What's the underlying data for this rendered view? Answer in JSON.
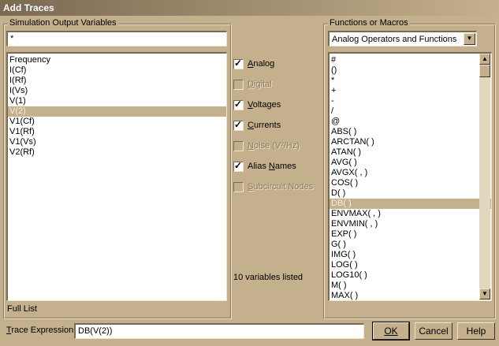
{
  "window": {
    "title": "Add Traces"
  },
  "simulation_group": {
    "legend": "Simulation Output Variables",
    "filter_value": "*",
    "variables": [
      "Frequency",
      "I(Cf)",
      "I(Rf)",
      "I(Vs)",
      "V(1)",
      "V(2)",
      "V1(Cf)",
      "V1(Rf)",
      "V1(Vs)",
      "V2(Rf)"
    ],
    "selected_index": 5,
    "full_list_label": "Full List"
  },
  "options": [
    {
      "label": "Analog",
      "accel": "A",
      "checked": true,
      "enabled": true
    },
    {
      "label": "Digital",
      "accel": "D",
      "checked": false,
      "enabled": false
    },
    {
      "label": "Voltages",
      "accel": "V",
      "checked": true,
      "enabled": true
    },
    {
      "label": "Currents",
      "accel": "C",
      "checked": true,
      "enabled": true
    },
    {
      "label": "Noise (V²/Hz)",
      "accel": "N",
      "checked": false,
      "enabled": false
    },
    {
      "label": "Alias Names",
      "accel": "N",
      "checked": true,
      "enabled": true
    },
    {
      "label": "Subcircuit Nodes",
      "accel": "S",
      "checked": false,
      "enabled": false
    }
  ],
  "variables_count": "10 variables listed",
  "functions_group": {
    "legend": "Functions or Macros",
    "dropdown_value": "Analog Operators and Functions",
    "items": [
      "#",
      "()",
      "*",
      "+",
      "-",
      "/",
      "@",
      "ABS( )",
      "ARCTAN( )",
      "ATAN( )",
      "AVG( )",
      "AVGX( , )",
      "COS( )",
      "D( )",
      "DB( )",
      "ENVMAX( , )",
      "ENVMIN( , )",
      "EXP( )",
      "G( )",
      "IMG( )",
      "LOG( )",
      "LOG10( )",
      "M( )",
      "MAX( )"
    ],
    "selected_index": 14
  },
  "trace_expression": {
    "label": "Trace Expression:",
    "value": "DB(V(2))"
  },
  "buttons": {
    "ok": "OK",
    "cancel": "Cancel",
    "help": "Help"
  }
}
